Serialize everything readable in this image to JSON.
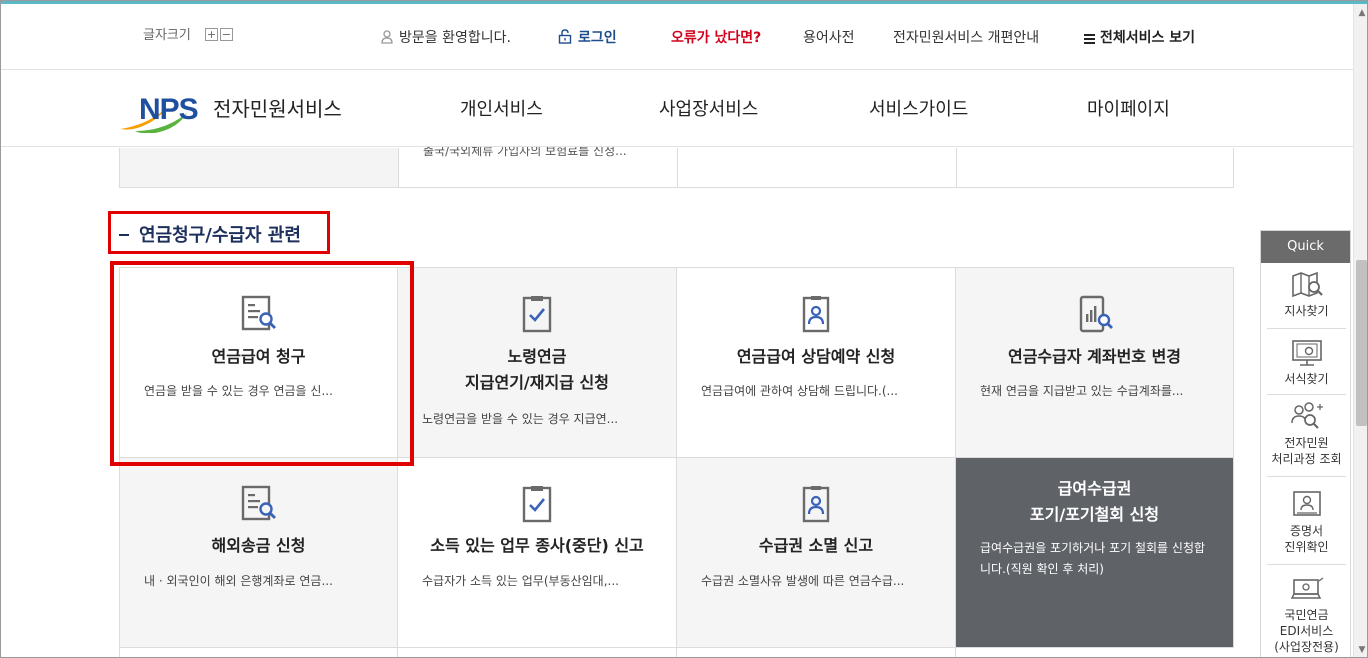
{
  "utility": {
    "font_size_label": "글자크기",
    "font_plus": "+",
    "font_minus": "−",
    "welcome": "방문을 환영합니다.",
    "login": "로그인",
    "error_report": "오류가 났다면?",
    "glossary": "용어사전",
    "renewal_notice": "전자민원서비스 개편안내",
    "all_services": "전체서비스 보기"
  },
  "header": {
    "logo_text": "NPS",
    "site_name": "전자민원서비스",
    "nav": [
      "개인서비스",
      "사업장서비스",
      "서비스가이드",
      "마이페이지"
    ]
  },
  "previous_row": {
    "text": "출국/국외체류 가입자의 보험료를 신청..."
  },
  "section": {
    "title": "연금청구/수급자 관련"
  },
  "cards": [
    {
      "icon": "document-search-icon",
      "title_lines": [
        "연금급여 청구"
      ],
      "desc": "연금을 받을 수 있는 경우 연금을 신..."
    },
    {
      "icon": "clipboard-check-icon",
      "title_lines": [
        "노령연금",
        "지급연기/재지급 신청"
      ],
      "desc": "노령연금을 받을 수 있는 경우 지급연..."
    },
    {
      "icon": "clipboard-person-icon",
      "title_lines": [
        "연금급여 상담예약 신청"
      ],
      "desc": "연금급여에 관하여 상담해 드립니다.(..."
    },
    {
      "icon": "phone-chart-search-icon",
      "title_lines": [
        "연금수급자 계좌번호 변경"
      ],
      "desc": "현재 연금을 지급받고 있는 수급계좌를..."
    },
    {
      "icon": "document-search-icon",
      "title_lines": [
        "해외송금 신청"
      ],
      "desc": "내 · 외국인이 해외 은행계좌로 연금..."
    },
    {
      "icon": "clipboard-check-icon",
      "title_lines": [
        "소득 있는 업무 종사(중단) 신고"
      ],
      "desc": "수급자가 소득 있는 업무(부동산임대,..."
    },
    {
      "icon": "clipboard-person-icon",
      "title_lines": [
        "수급권 소멸 신고"
      ],
      "desc": "수급권 소멸사유 발생에 따른 연금수급..."
    },
    {
      "icon": "",
      "title_lines": [
        "급여수급권",
        "포기/포기철회 신청"
      ],
      "desc": "급여수급권을 포기하거나 포기 철회를 신청합니다.(직원 확인 후 처리)"
    }
  ],
  "quick": {
    "title": "Quick",
    "items": [
      {
        "icon": "map-search-icon",
        "lines": [
          "지사찾기"
        ]
      },
      {
        "icon": "monitor-icon",
        "lines": [
          "서식찾기"
        ]
      },
      {
        "icon": "people-search-icon",
        "lines": [
          "전자민원",
          "처리과정 조회"
        ]
      },
      {
        "icon": "id-card-icon",
        "lines": [
          "증명서",
          "진위확인"
        ]
      },
      {
        "icon": "edi-computer-icon",
        "lines": [
          "국민연금",
          "EDI서비스",
          "(사업장전용)"
        ]
      }
    ]
  },
  "colors": {
    "accent_navy": "#1d2f5c",
    "error_red": "#d0021b",
    "highlight_red": "#e00000",
    "dark_card": "#5f6368",
    "icon_grey": "#6a6a6a",
    "icon_blue": "#3a63b8"
  }
}
